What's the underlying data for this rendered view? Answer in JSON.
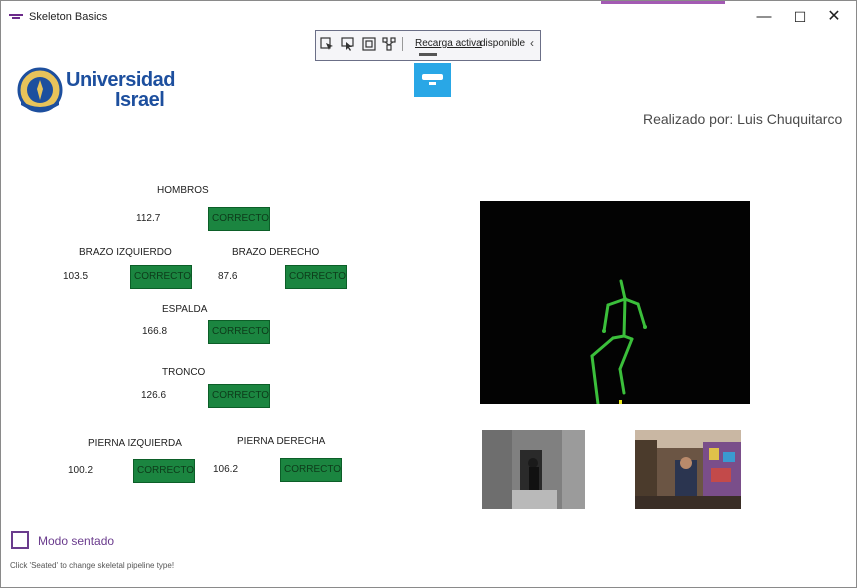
{
  "window": {
    "title": "Skeleton Basics",
    "controls": {
      "minimize": "—",
      "maximize": "☐",
      "close": "✕"
    }
  },
  "toolbar": {
    "icons": [
      "select-element-icon",
      "pointer-icon",
      "frame-icon",
      "layout-icon"
    ],
    "link_text": "Recarga activa",
    "status_text": "disponible",
    "chevron": "‹"
  },
  "header": {
    "logo_line1": "Universidad",
    "logo_line2": "Israel",
    "author": "Realizado por: Luis Chuquitarco"
  },
  "measurements": {
    "hombros": {
      "label": "HOMBROS",
      "value": "112.7",
      "status": "CORRECTO"
    },
    "brazo_izquierdo": {
      "label": "BRAZO IZQUIERDO",
      "value": "103.5",
      "status": "CORRECTO"
    },
    "brazo_derecho": {
      "label": "BRAZO DERECHO",
      "value": "87.6",
      "status": "CORRECTO"
    },
    "espalda": {
      "label": "ESPALDA",
      "value": "166.8",
      "status": "CORRECTO"
    },
    "tronco": {
      "label": "TRONCO",
      "value": "126.6",
      "status": "CORRECTO"
    },
    "pierna_izquierda": {
      "label": "PIERNA IZQUIERDA",
      "value": "100.2",
      "status": "CORRECTO"
    },
    "pierna_derecha": {
      "label": "PIERNA DERECHA",
      "value": "106.2",
      "status": "CORRECTO"
    }
  },
  "colors": {
    "status_green": "#1b8540",
    "skeleton_bone": "#3bbf3b",
    "accent_purple": "#6a3b8d",
    "logo_blue": "#1d4f9e"
  },
  "footer": {
    "seated_label": "Modo sentado",
    "seated_checked": false,
    "hint": "Click 'Seated' to change skeletal pipeline type!"
  }
}
